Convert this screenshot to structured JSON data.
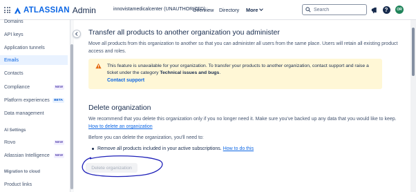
{
  "header": {
    "brand": "ATLASSIAN",
    "product": "Admin",
    "org": "innovistamedicalcenter (UNAUTHORIZED)",
    "nav": [
      "Overview",
      "Directory",
      "More"
    ],
    "search_placeholder": "Search",
    "avatar_initials": "OR",
    "help_glyph": "?"
  },
  "sidebar": {
    "items": [
      {
        "label": "Domains"
      },
      {
        "label": "API keys"
      },
      {
        "label": "Application tunnels"
      },
      {
        "label": "Emails",
        "active": true
      },
      {
        "label": "Contacts"
      },
      {
        "label": "Compliance",
        "badge": "NEW"
      },
      {
        "label": "Platform experiences",
        "badge": "BETA"
      },
      {
        "label": "Data management"
      }
    ],
    "section_ai": "AI Settings",
    "ai_items": [
      {
        "label": "Rovo",
        "badge": "NEW"
      },
      {
        "label": "Atlassian Intelligence",
        "badge": "NEW"
      }
    ],
    "section_migration": "Migration to cloud",
    "migration_items": [
      {
        "label": "Product links"
      }
    ]
  },
  "transfer": {
    "title": "Transfer all products to another organization you administer",
    "description": "Move all products from this organization to another so that you can administer all users from the same place. Users will retain all existing product access and roles.",
    "warning_text_1": "This feature is unavailable for your organization. To transfer your products to another organization, contact support and raise a ticket under the category ",
    "warning_bold": "Technical issues and bugs",
    "warning_text_2": ".",
    "warning_link": "Contact support"
  },
  "delete": {
    "title": "Delete organization",
    "description": "We recommend that you delete this organization only if you no longer need it. Make sure you've backed up any data that you would like to keep. ",
    "description_link": "How to delete an organization",
    "prereq": "Before you can delete the organization, you'll need to:",
    "bullet": "Remove all products included in your active subscriptions. ",
    "bullet_link": "How to do this",
    "button": "Delete organization"
  },
  "colors": {
    "brand_blue": "#0c66e4",
    "warning_bg": "#fff7d6",
    "warning_icon": "#e56910",
    "annotation": "#1d1fb8",
    "avatar_bg": "#1f845a"
  }
}
